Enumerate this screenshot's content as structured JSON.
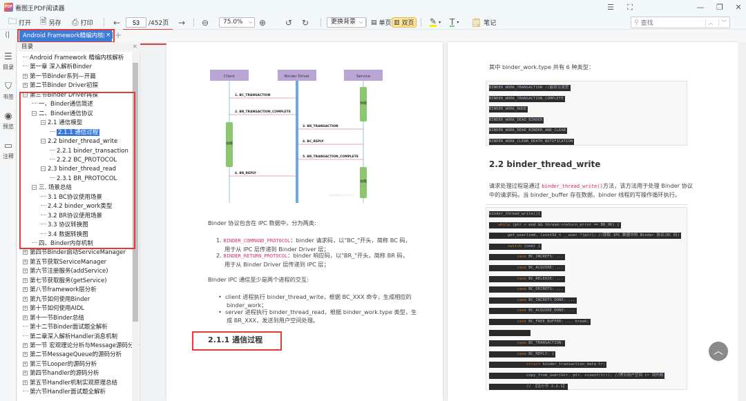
{
  "app": {
    "title": "看图王PDF阅读器",
    "logo_text": "PDF"
  },
  "window": {
    "menu": "☰",
    "fullscreen": "⛶",
    "minimize": "—",
    "restore": "❐",
    "close": "✕"
  },
  "toolbar": {
    "open": "打开",
    "save_as": "另存",
    "print": "打印",
    "current_page": "53",
    "total_pages": "/452页",
    "zoom": "75.0%",
    "background": "更换背景",
    "single_page": "单页",
    "double_page": "双页",
    "notes": "笔记",
    "search_placeholder": "查找",
    "highlight_color": "#ffeb00",
    "text_color": "#7ac97a"
  },
  "tabs": [
    {
      "label": "Android Framework精编内核解析",
      "close": "×"
    }
  ],
  "tab_add": "+",
  "rail": [
    {
      "label": "目录",
      "icon": "list-icon"
    },
    {
      "label": "书签",
      "icon": "bookmark-icon"
    },
    {
      "label": "预览",
      "icon": "eye-icon"
    },
    {
      "label": "注释",
      "icon": "comment-icon"
    }
  ],
  "toc": {
    "title": "目录",
    "close": "×",
    "items": [
      {
        "label": "Android Framework 精编内核解析",
        "level": 0,
        "exp": ""
      },
      {
        "label": "第一章 深入解析Binder",
        "level": 0,
        "exp": ""
      },
      {
        "label": "第一节Binder系列—开篇",
        "level": 0,
        "exp": "+"
      },
      {
        "label": "第二节Binder Driver初探",
        "level": 0,
        "exp": "+"
      },
      {
        "label": "第三节Binder Driver再探",
        "level": 0,
        "exp": "-"
      },
      {
        "label": "一、Binder通信简述",
        "level": 1,
        "exp": ""
      },
      {
        "label": "二、Binder通信协议",
        "level": 1,
        "exp": "-"
      },
      {
        "label": "2.1 通信模型",
        "level": 2,
        "exp": "-"
      },
      {
        "label": "2.1.1 通信过程",
        "level": 3,
        "exp": "",
        "selected": true
      },
      {
        "label": "2.2 binder_thread_write",
        "level": 2,
        "exp": "-"
      },
      {
        "label": "2.2.1 binder_transaction",
        "level": 3,
        "exp": ""
      },
      {
        "label": "2.2.2 BC_PROTOCOL",
        "level": 3,
        "exp": ""
      },
      {
        "label": "2.3 binder_thread_read",
        "level": 2,
        "exp": "-"
      },
      {
        "label": "2.3.1 BR_PROTOCOL",
        "level": 3,
        "exp": ""
      },
      {
        "label": "三. 场景总结",
        "level": 1,
        "exp": "-"
      },
      {
        "label": "3.1 BC协议使用场景",
        "level": 2,
        "exp": ""
      },
      {
        "label": "2.4.2 binder_work类型",
        "level": 2,
        "exp": ""
      },
      {
        "label": "3.2 BR协议使用场景",
        "level": 2,
        "exp": ""
      },
      {
        "label": "3.3 协议转换图",
        "level": 2,
        "exp": ""
      },
      {
        "label": "3.4 数据转换图",
        "level": 2,
        "exp": ""
      },
      {
        "label": "四、Binder内存机制",
        "level": 1,
        "exp": ""
      },
      {
        "label": "第四节Binder启动ServiceManager",
        "level": 0,
        "exp": "+"
      },
      {
        "label": "第五节获取ServiceManager",
        "level": 0,
        "exp": "+"
      },
      {
        "label": "第六节注册服务(addService)",
        "level": 0,
        "exp": "+"
      },
      {
        "label": "第七节获取服务(getService)",
        "level": 0,
        "exp": "+"
      },
      {
        "label": "第八节framework层分析",
        "level": 0,
        "exp": "+"
      },
      {
        "label": "第九节如何使用Binder",
        "level": 0,
        "exp": "+"
      },
      {
        "label": "第十节如何使用AIDL",
        "level": 0,
        "exp": "+"
      },
      {
        "label": "第十一节Binder总结",
        "level": 0,
        "exp": "+"
      },
      {
        "label": "第十二节Binder面试题全解析",
        "level": 0,
        "exp": ""
      },
      {
        "label": "第二章深入解析Handler消息机制",
        "level": 0,
        "exp": ""
      },
      {
        "label": "第一节 宏观理论分析与Message源码分析",
        "level": 0,
        "exp": "+"
      },
      {
        "label": "第二节MessageQueue的源码分析",
        "level": 0,
        "exp": "+"
      },
      {
        "label": "第三节Looper的源码分析",
        "level": 0,
        "exp": "+"
      },
      {
        "label": "第四节handler的源码分析",
        "level": 0,
        "exp": "+"
      },
      {
        "label": "第五节Handler机制实现原理总结",
        "level": 0,
        "exp": "+"
      },
      {
        "label": "第六节Handler面试题全解析",
        "level": 0,
        "exp": ""
      }
    ]
  },
  "page1": {
    "diagram": {
      "actors": [
        "Client",
        "Binder Driver",
        "Service"
      ],
      "messages": [
        "1. BC_TRANSACTION",
        "2. BR_TRANSACTION_COMPLETE",
        "3. BR_TRANSACTION",
        "4. BC_REPLY",
        "5. BR_TRANSACTION_COMPLETE",
        "6. BR_REPLY"
      ],
      "sleep": "休眠",
      "watermark": "www.gityuan.com"
    },
    "p1": "Binder 协议包含在 IPC 数据中，分为两类:",
    "list": [
      {
        "num": "1.",
        "code": "BINDER_COMMAND_PROTOCOL",
        "text": "：binder 请求码，以\"BC_\"开头，简称 BC 码，",
        "text2": "用于从 IPC 层传递到 Binder Driver 层；"
      },
      {
        "num": "2.",
        "code": "BINDER_RETURN_PROTOCOL",
        "text": "：binder 响应码，以\"BR_\"开头，简称 BR 码，",
        "text2": "用于从 Binder Driver 层传递到 IPC 层；"
      }
    ],
    "p2": "Binder IPC 通信至少是两个进程的交互:",
    "bullets": [
      {
        "text": "client 进程执行 binder_thread_write，根据 BC_XXX 命令，生成相应的",
        "text2": "binder_work；"
      },
      {
        "text": "server 进程执行 binder_thread_read，根据 binder_work.type 类型，生",
        "text2": "成 BR_XXX，发送到用户空间处理。"
      }
    ],
    "heading": "2.1.1  通信过程"
  },
  "page2": {
    "p1": "其中 binder_work.type 共有 6 种类型：",
    "types": [
      "BINDER_WORK_TRANSACTION //最常见类型",
      "BINDER_WORK_TRANSACTION_COMPLETE",
      "BINDER_WORK_NODE",
      "BINDER_WORK_DEAD_BINDER",
      "BINDER_WORK_DEAD_BINDER_AND_CLEAR",
      "BINDER_WORK_CLEAR_DEATH_NOTIFICATION"
    ],
    "heading": "2.2 binder_thread_write",
    "p2a": "请求处理过程是通过 ",
    "p2code": "binder_thread_write()",
    "p2b": "方法，该方法用于处理 Binder 协议",
    "p2c": "中的请求码。当 binder_buffer 存在数据，binder 线程的写操作循环执行。",
    "code": [
      {
        "indent": "",
        "kw": "",
        "text": "binder_thread_write(){"
      },
      {
        "indent": "    ",
        "kw": "while",
        "text": " (ptr < end && thread->return_error == BR_OK) {"
      },
      {
        "indent": "        ",
        "kw": "",
        "text": "get_user(cmd, (uint32_t __user *)ptr); //获取 IPC 数据中的 Binder 协议(BC 码)"
      },
      {
        "indent": "        ",
        "kw": "switch",
        "text": " (cmd) {"
      },
      {
        "indent": "            ",
        "kw": "case",
        "text": " BC_INCREFS: ..."
      },
      {
        "indent": "            ",
        "kw": "case",
        "text": " BC_ACQUIRE: ..."
      },
      {
        "indent": "            ",
        "kw": "case",
        "text": " BC_RELEASE: ..."
      },
      {
        "indent": "            ",
        "kw": "case",
        "text": " BC_DECREFS: ..."
      },
      {
        "indent": "            ",
        "kw": "case",
        "text": " BC_INCREFS_DONE: ..."
      },
      {
        "indent": "            ",
        "kw": "case",
        "text": " BC_ACQUIRE_DONE: ..."
      },
      {
        "indent": "            ",
        "kw": "case",
        "text": " BC_FREE_BUFFER: ... break;"
      },
      {
        "indent": "            ",
        "kw": "",
        "text": ""
      },
      {
        "indent": "            ",
        "kw": "case",
        "text": " BC_TRANSACTION:"
      },
      {
        "indent": "            ",
        "kw": "case",
        "text": " BC_REPLY: {"
      },
      {
        "indent": "                ",
        "kw": "struct",
        "text": " binder_transaction_data tr;"
      },
      {
        "indent": "                ",
        "kw": "",
        "text": "copy_from_user(&tr, ptr, sizeof(tr)); //拷贝用户空间 tr 到内核"
      },
      {
        "indent": "                ",
        "kw": "",
        "text": "// 【见小节 2.2.1】"
      }
    ]
  },
  "scroll_top": "︿"
}
